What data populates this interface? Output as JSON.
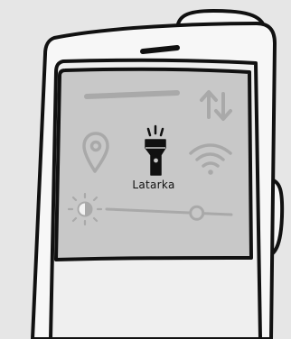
{
  "phone": {
    "quick_settings": {
      "flashlight": {
        "label": "Latarka",
        "icon": "flashlight-icon",
        "state": "on"
      },
      "location": {
        "icon": "location-pin-icon",
        "state": "off"
      },
      "wifi": {
        "icon": "wifi-icon",
        "state": "off"
      },
      "mobile_data": {
        "icon": "data-transfer-arrows-icon",
        "state": "off"
      },
      "brightness": {
        "icon": "brightness-icon",
        "level_percent": 85
      }
    }
  },
  "colors": {
    "background": "#e6e6e6",
    "phone_body": "#f7f7f7",
    "screen_panel": "#c8c8c8",
    "dim_icon": "#a9a9a9",
    "outline": "#111111"
  }
}
